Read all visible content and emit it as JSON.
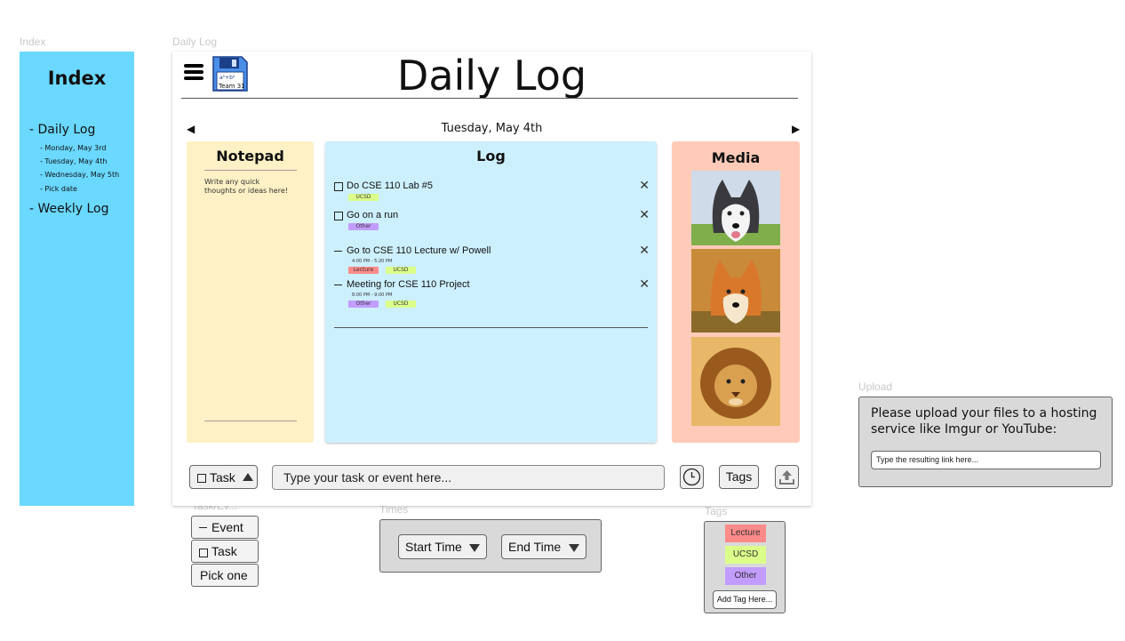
{
  "frame_labels": {
    "index": "Index",
    "daily_log": "Daily Log",
    "task_event": "Task/Ev...",
    "times": "Times",
    "tags": "Tags",
    "upload": "Upload"
  },
  "index": {
    "title": "Index",
    "daily_log": "- Daily Log",
    "days": [
      "- Monday, May 3rd",
      "- Tuesday, May 4th",
      "- Wednesday, May 5th",
      "- Pick date"
    ],
    "weekly_log": "- Weekly Log",
    "background": "#6ad8ff"
  },
  "header": {
    "title": "Daily Log",
    "save_icon_caption": "Team 31",
    "menu_icon": "hamburger-icon",
    "save_icon": "floppy-disk-icon"
  },
  "date_nav": {
    "date": "Tuesday, May 4th",
    "prev": "◀",
    "next": "▶"
  },
  "notepad": {
    "title": "Notepad",
    "placeholder": "Write any quick thoughts or ideas here!"
  },
  "log": {
    "title": "Log",
    "tasks": [
      {
        "text": "Do CSE 110 Lab #5",
        "tags": [
          "UCSD"
        ]
      },
      {
        "text": "Go on a run",
        "tags": [
          "Other"
        ]
      }
    ],
    "events": [
      {
        "text": "Go to CSE 110 Lecture w/ Powell",
        "time": "4:00 PM - 5:20 PM",
        "tags": [
          "Lecture",
          "UCSD"
        ]
      },
      {
        "text": "Meeting for CSE 110 Project",
        "time": "8:00 PM - 9:00 PM",
        "tags": [
          "Other",
          "UCSD"
        ]
      }
    ],
    "delete_glyph": "✕"
  },
  "media": {
    "title": "Media",
    "photos": [
      "husky-photo",
      "shiba-photo",
      "lion-photo"
    ]
  },
  "toolbar": {
    "type_label": "Task",
    "input_placeholder": "Type your task or event here...",
    "tags_label": "Tags",
    "clock_icon": "clock-icon",
    "upload_icon": "upload-icon"
  },
  "task_event_menu": {
    "options": [
      "Event",
      "Task",
      "Pick one"
    ]
  },
  "times": {
    "start": "Start Time",
    "end": "End Time"
  },
  "tags_menu": {
    "options": [
      "Lecture",
      "UCSD",
      "Other"
    ],
    "add_placeholder": "Add Tag Here...",
    "colors": {
      "Lecture": "#ff8a8a",
      "UCSD": "#dcff8a",
      "Other": "#c39cff"
    }
  },
  "upload": {
    "message": "Please upload your files to a hosting service like Imgur or YouTube:",
    "input_placeholder": "Type the resulting link here..."
  }
}
